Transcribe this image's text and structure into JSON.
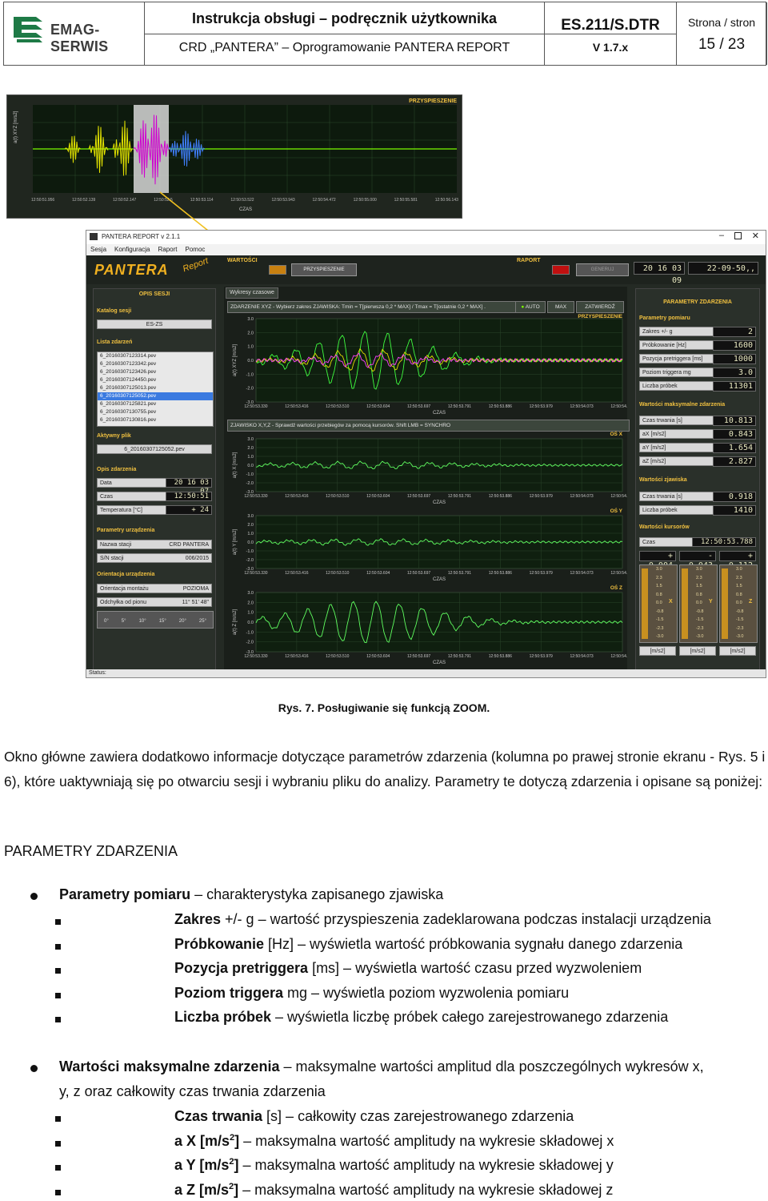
{
  "header": {
    "company": "EMAG-SERWIS",
    "title": "Instrukcja obsługi – podręcznik użytkownika",
    "subtitle": "CRD „PANTERA” – Oprogramowanie PANTERA REPORT",
    "doc_code": "ES.211/S.DTR",
    "version": "V 1.7.x",
    "page_label": "Strona / stron",
    "page": "15 / 23"
  },
  "zoom_overview": {
    "title": "PRZYSPIESZENIE",
    "ylabel": "a(t) XYZ [m/s2]",
    "xlabel": "CZAS",
    "ticks": [
      "12:50:51.956",
      "12:50:52.139",
      "12:50:52.147",
      "12:50:52.5",
      "12:50:53.114",
      "12:50:53.522",
      "12:50:53.943",
      "12:50:54.472",
      "12:50:55.000",
      "12:50:55.581",
      "12:50:56.143"
    ]
  },
  "app": {
    "window_title": "PANTERA REPORT v 2.1.1",
    "menu": [
      "Sesja",
      "Konfiguracja",
      "Raport",
      "Pomoc"
    ],
    "logo": "PANTERA",
    "logo_sub": "Report",
    "wartosci_label": "WARTOŚCI",
    "przyspieszenie_btn": "PRZYSPIESZENIE",
    "raport_label": "RAPORT",
    "generuj_btn": "GENERUJ",
    "date_lcd": "20 16 03 09",
    "time_lcd": "22-09-50,,",
    "left": {
      "opis_sesji": "OPIS SESJI",
      "katalog_label": "Katalog sesji",
      "katalog_value": "ES-ZS",
      "lista_label": "Lista zdarzeń",
      "files": [
        "6_20160307123314.pev",
        "6_20160307123342.pev",
        "6_20160307123426.pev",
        "6_20160307124450.pev",
        "6_20160307125013.pev",
        "6_20160307125052.pev",
        "6_20160307125821.pev",
        "6_20160307130755.pev",
        "6_20160307130816.pev"
      ],
      "selected_index": 5,
      "aktywny_label": "Aktywny plik",
      "aktywny_value": "6_20160307125052.pev",
      "opis_zdarzenia": "Opis zdarzenia",
      "data_label": "Data",
      "data_value": "20 16 03 07",
      "czas_label": "Czas",
      "czas_value": "12:50:51",
      "temp_label": "Temperatura [°C]",
      "temp_value": "+ 24",
      "param_urz": "Parametry urządzenia",
      "nazwa_label": "Nazwa stacji",
      "nazwa_value": "CRD PANTERA",
      "sn_label": "S/N stacji",
      "sn_value": "006/2015",
      "orient_label": "Orientacja urządzenia",
      "orient_m_label": "Orientacja montażu",
      "orient_m_value": "POZIOMA",
      "odchylka_label": "Odchyłka od pionu",
      "odchylka_value": "11° 51' 48\"",
      "scale": [
        "0°",
        "5°",
        "10°",
        "15°",
        "20°",
        "25°"
      ]
    },
    "center": {
      "tab": "Wykresy czasowe",
      "bar1": "ZDARZENIE XYZ - Wybierz zakres ZJAWISKA: Tmin = T[pierwsza 0,2 * MAX] / Tmax = T[ostatnie 0,2 * MAX] .",
      "btn_auto": "AUTO",
      "btn_max": "MAX",
      "btn_zatw": "ZATWIERDŹ",
      "bar2": "ZJAWISKO X,Y,Z - Sprawdź wartości przebiegów za pomocą kursorów. Shift LMB = SYNCHRO",
      "plot_title": "PRZYSPIESZENIE",
      "axis_x": "OŚ X",
      "axis_y": "OŚ Y",
      "axis_z": "OŚ Z",
      "ylabel_xyz": "a(t) XYZ [m/s2]",
      "ylabel_x": "a(t) X [m/s2]",
      "ylabel_y": "a(t) Y [m/s2]",
      "ylabel_z": "a(t) Z [m/s2]",
      "czas": "CZAS",
      "yticks": [
        "3.0",
        "2.0",
        "1.0",
        "0.0",
        "-1.0",
        "-2.0",
        "-3.0"
      ],
      "xticks": [
        "12:50:53.330",
        "12:50:53.416",
        "12:50:53.510",
        "12:50:53.604",
        "12:50:53.697",
        "12:50:53.791",
        "12:50:53.886",
        "12:50:53.979",
        "12:50:54.073",
        "12:50:54.167"
      ]
    },
    "right": {
      "title": "PARAMETRY ZDARZENIA",
      "pomiar_label": "Parametry pomiaru",
      "rows1": [
        [
          "Zakres +/- g",
          "2"
        ],
        [
          "Próbkowanie [Hz]",
          "1600"
        ],
        [
          "Pozycja pretriggera [ms]",
          "1000"
        ],
        [
          "Poziom triggera mg",
          "3.0"
        ],
        [
          "Liczba próbek",
          "11301"
        ]
      ],
      "max_label": "Wartości maksymalne zdarzenia",
      "rows2": [
        [
          "Czas trwania [s]",
          "10.813"
        ],
        [
          "aX [m/s2]",
          "0.843"
        ],
        [
          "aY [m/s2]",
          "1.654"
        ],
        [
          "aZ [m/s2]",
          "2.827"
        ]
      ],
      "zjaw_label": "Wartości zjawiska",
      "rows3": [
        [
          "Czas trwania [s]",
          "0.918"
        ],
        [
          "Liczba próbek",
          "1410"
        ]
      ],
      "kurs_label": "Wartości kursorów",
      "czas_label": "Czas",
      "czas_value": "12:50:53.788",
      "kx": "+ 0.004",
      "ky": "- 0.043",
      "kz": "+ 0.112",
      "gauge_ticks": [
        "3.0",
        "2.3",
        "1.5",
        "0.8",
        "0.0",
        "-0.8",
        "-1.5",
        "-2.3",
        "-3.0"
      ],
      "gauge_names": [
        "X",
        "Y",
        "Z"
      ],
      "unit": "[m/s2]"
    },
    "status": "Status:"
  },
  "caption": "Rys. 7. Posługiwanie się funkcją ZOOM.",
  "paragraph": "Okno główne zawiera dodatkowo informacje dotyczące parametrów zdarzenia (kolumna po prawej stronie ekranu - Rys. 5 i 6), które uaktywniają się po otwarciu sesji i wybraniu pliku do analizy. Parametry te dotyczą zdarzenia i opisane są poniżej:",
  "section_title": "PARAMETRY ZDARZENIA",
  "b1": {
    "term": "Parametry pomiaru",
    "text": " – charakterystyka zapisanego zjawiska"
  },
  "sub1": [
    {
      "term": "Zakres",
      "text": " +/- g – wartość przyspieszenia zadeklarowana podczas instalacji urządzenia"
    },
    {
      "term": "Próbkowanie",
      "text": " [Hz] – wyświetla wartość próbkowania sygnału danego zdarzenia"
    },
    {
      "term": "Pozycja pretriggera",
      "text": " [ms] – wyświetla wartość czasu przed wyzwoleniem"
    },
    {
      "term": "Poziom triggera",
      "text": " mg – wyświetla poziom wyzwolenia pomiaru"
    },
    {
      "term": "Liczba próbek",
      "text": " – wyświetla liczbę próbek całego zarejestrowanego zdarzenia"
    }
  ],
  "b2": {
    "term": "Wartości maksymalne zdarzenia",
    "text": " – maksymalne wartości amplitud dla poszczególnych wykresów x,",
    "text2": "y, z oraz całkowity czas trwania zdarzenia"
  },
  "sub2": [
    {
      "term": "Czas trwania",
      "text": " [s] – całkowity czas zarejestrowanego zdarzenia"
    },
    {
      "term": "a X [m/s",
      "sup": "2",
      "term_end": "]",
      "text": " – maksymalna wartość amplitudy na wykresie składowej x"
    },
    {
      "term": "a Y [m/s",
      "sup": "2",
      "term_end": "]",
      "text": " – maksymalna wartość amplitudy na wykresie składowej y"
    },
    {
      "term": "a Z [m/s",
      "sup": "2",
      "term_end": "]",
      "text": " – maksymalna wartość amplitudy na wykresie składowej z"
    }
  ]
}
